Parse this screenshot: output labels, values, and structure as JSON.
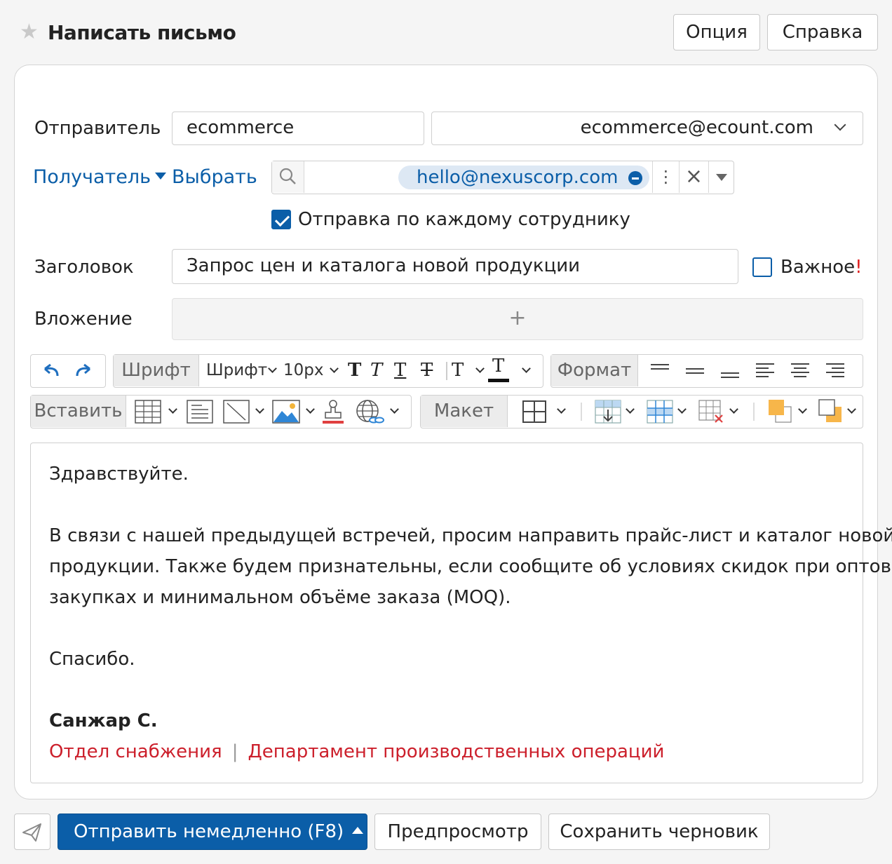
{
  "header": {
    "title": "Написать письмо",
    "option_label": "Опция",
    "help_label": "Справка"
  },
  "form": {
    "sender_label": "Отправитель",
    "sender_name": "ecommerce",
    "sender_email": "ecommerce@ecount.com",
    "recipient_label": "Получатель",
    "select_label": "Выбрать",
    "recipient_chip": "hello@nexuscorp.com",
    "send_each_label": "Отправка по каждому сотруднику",
    "send_each_checked": true,
    "subject_label": "Заголовок",
    "subject_value": "Запрос цен и каталога новой продукции",
    "important_label": "Важное",
    "important_mark": "!",
    "important_checked": false,
    "attachment_label": "Вложение",
    "attachment_add": "+"
  },
  "toolbar": {
    "font_group_label": "Шрифт",
    "font_family": "Шрифт",
    "font_size": "10px",
    "format_group_label": "Формат",
    "insert_group_label": "Вставить",
    "layout_group_label": "Макет"
  },
  "body": {
    "greeting": "Здравствуйте.",
    "paragraph_line1": "В связи с нашей предыдущей встречей, просим направить прайс-лист и каталог новой",
    "paragraph_line2": "продукции. Также будем признательны, если сообщите об условиях скидок при оптовых",
    "paragraph_line3": "закупках и минимальном объёме заказа (MOQ).",
    "thanks": "Спасибо.",
    "signature_name": "Санжар С.",
    "signature_dept": "Отдел снабжения",
    "signature_separator": "|",
    "signature_division": "Департамент производственных операций"
  },
  "footer": {
    "send_label": "Отправить немедленно (F8)",
    "preview_label": "Предпросмотр",
    "draft_label": "Сохранить черновик"
  },
  "colors": {
    "accent": "#0b5ea8",
    "signature_red": "#cc1f2b"
  }
}
